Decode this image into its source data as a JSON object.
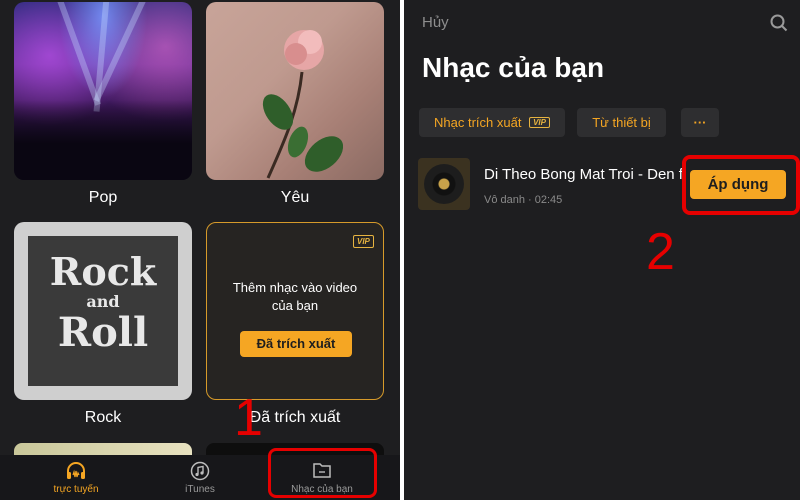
{
  "left": {
    "categories": [
      {
        "label": "Pop"
      },
      {
        "label": "Yêu"
      },
      {
        "label": "Rock"
      },
      {
        "label": "Đã trích xuất"
      }
    ],
    "rock_artwork": {
      "line1": "Rock",
      "line2": "and",
      "line3": "Roll"
    },
    "extract_card": {
      "badge": "VIP",
      "text_line1": "Thêm nhạc vào video",
      "text_line2": "của bạn",
      "button": "Đã trích xuất"
    },
    "tabs": [
      {
        "label": "trực tuyến",
        "icon": "headphones-icon",
        "active": true
      },
      {
        "label": "iTunes",
        "icon": "music-note-icon",
        "active": false
      },
      {
        "label": "Nhạc của bạn",
        "icon": "folder-icon",
        "active": false
      }
    ],
    "step_marker": "1"
  },
  "right": {
    "cancel": "Hủy",
    "title": "Nhạc của bạn",
    "chips": [
      {
        "label": "Nhạc trích xuất",
        "badge": "VIP"
      },
      {
        "label": "Từ thiết bị"
      },
      {
        "label": "···"
      }
    ],
    "track": {
      "title": "Di Theo Bong Mat Troi - Den f",
      "meta": "Vô danh · 02:45",
      "apply": "Áp dụng"
    },
    "step_marker": "2"
  },
  "colors": {
    "accent": "#f5a623",
    "highlight": "#e60000",
    "background": "#1e1e20"
  }
}
